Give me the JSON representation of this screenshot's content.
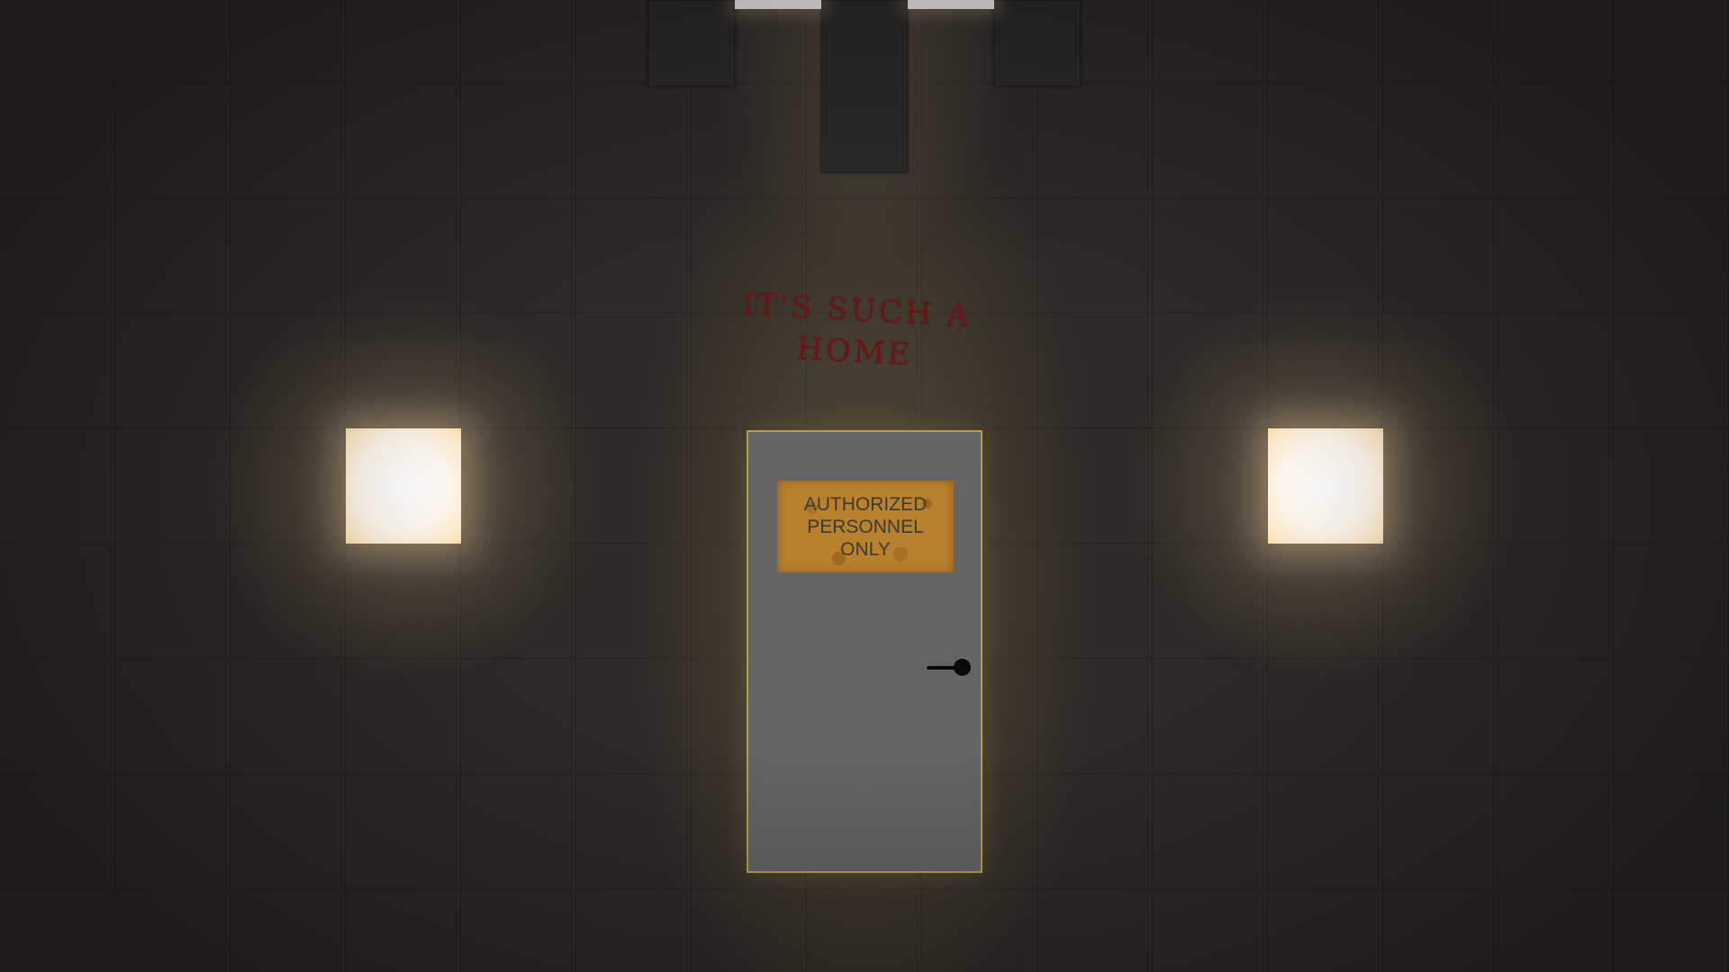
{
  "scene": {
    "graffiti": {
      "line1": "IT'S SUCH A",
      "line2": "HOME",
      "color": "#6b1616"
    },
    "door": {
      "sign": {
        "line1": "AUTHORIZED",
        "line2": "PERSONNEL",
        "line3": "ONLY",
        "color": "#b9802d"
      },
      "color": "#646464",
      "outline_color": "#b79f45"
    },
    "lights": {
      "wall_lamp_color": "#fff9ef",
      "ceiling_light_color": "#f4f1ea"
    },
    "icons": {
      "door_handle": "door-handle-icon"
    }
  }
}
